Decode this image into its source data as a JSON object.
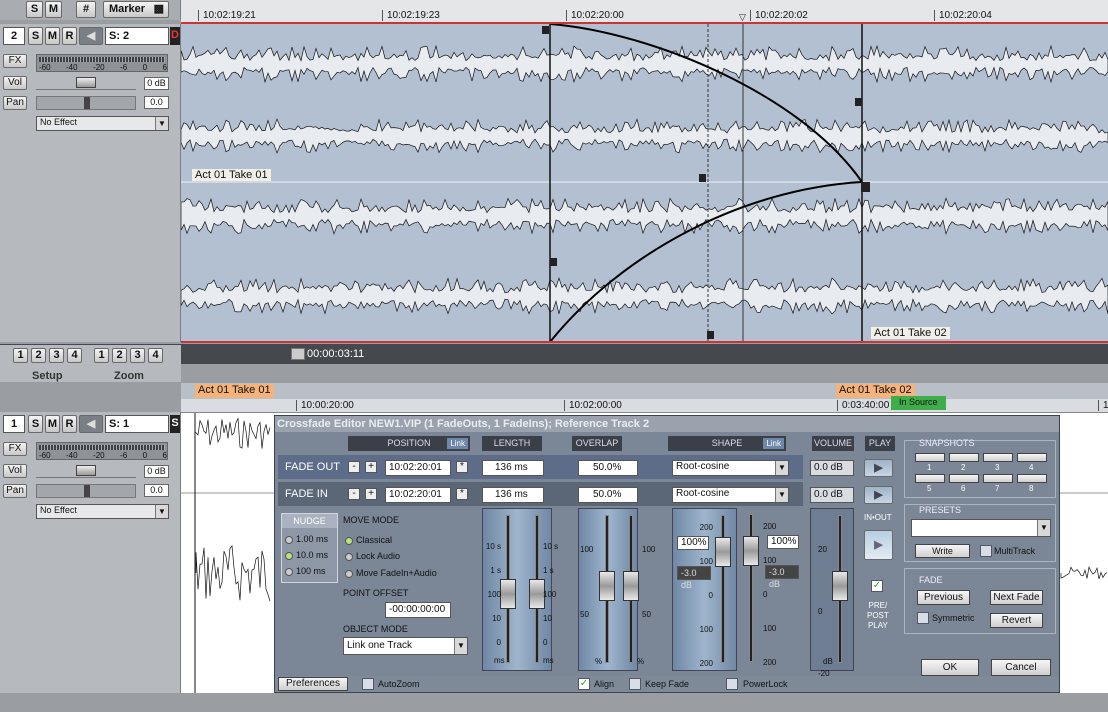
{
  "top_toolbar": {
    "s_label": "S",
    "m_label": "M",
    "grid_label": "#",
    "marker_label": "Marker"
  },
  "upper_ruler": {
    "times": [
      "10:02:19:21",
      "10:02:19:23",
      "10:02:20:00",
      "10:02:20:02",
      "10:02:20:04"
    ]
  },
  "track2": {
    "number": "2",
    "s": "S",
    "m": "M",
    "r": "R",
    "source": "S: 2",
    "d": "D",
    "fx": "FX",
    "vol": "Vol",
    "pan": "Pan",
    "vol_value": "0 dB",
    "pan_value": "0.0",
    "meter_scale": [
      "-60",
      "-40",
      "-20",
      "-6",
      "0",
      "6"
    ],
    "effect": "No Effect",
    "clip_a": "Act 01 Take 01",
    "clip_b": "Act 01 Take 02"
  },
  "transport": {
    "timecode": "00:00:03:11"
  },
  "setup": {
    "label": "Setup",
    "buttons": [
      "1",
      "2",
      "3",
      "4"
    ]
  },
  "zoom": {
    "label": "Zoom",
    "buttons": [
      "1",
      "2",
      "3",
      "4"
    ]
  },
  "lower_ruler": {
    "clip_a": "Act 01 Take 01",
    "clip_b": "Act 01 Take 02",
    "times": [
      "10:00:20:00",
      "10:02:00:00",
      "0:03:40:00",
      "1"
    ],
    "in_source": "In Source"
  },
  "track1": {
    "number": "1",
    "s": "S",
    "m": "M",
    "r": "R",
    "source": "S: 1",
    "side": "S",
    "fx": "FX",
    "vol": "Vol",
    "pan": "Pan",
    "vol_value": "0 dB",
    "pan_value": "0.0",
    "meter_scale": [
      "-60",
      "-40",
      "-20",
      "-6",
      "0",
      "6"
    ],
    "effect": "No Effect"
  },
  "dialog": {
    "title": "Crossfade Editor NEW1.VIP (1 FadeOuts, 1 FadeIns); Reference Track 2",
    "headers": {
      "position": "POSITION",
      "link": "Link",
      "length": "LENGTH",
      "overlap": "OVERLAP",
      "shape": "SHAPE",
      "shape_link": "Link",
      "volume": "VOLUME",
      "play": "PLAY"
    },
    "fade_out": {
      "label": "FADE OUT",
      "position": "10:02:20:01",
      "length": "136 ms",
      "overlap": "50.0%",
      "shape": "Root-cosine",
      "volume": "0.0 dB"
    },
    "fade_in": {
      "label": "FADE IN",
      "position": "10:02:20:01",
      "length": "136 ms",
      "overlap": "50.0%",
      "shape": "Root-cosine",
      "volume": "0.0 dB"
    },
    "minus": "-",
    "plus": "+",
    "star": "*",
    "nudge": {
      "title": "NUDGE",
      "options": [
        "1.00 ms",
        "10.0 ms",
        "100 ms"
      ],
      "selected": 1
    },
    "move_mode": {
      "title": "MOVE MODE",
      "options": [
        "Classical",
        "Lock Audio",
        "Move FadeIn+Audio"
      ],
      "selected": 0
    },
    "point_offset": {
      "title": "POINT OFFSET",
      "value": "-00:00:00:00"
    },
    "object_mode": {
      "title": "OBJECT MODE",
      "value": "Link one Track"
    },
    "length_scale_left": [
      "10 s",
      "1 s",
      "100",
      "10",
      "0"
    ],
    "length_scale_right": [
      "10 s",
      "1 s",
      "100",
      "10",
      "0"
    ],
    "length_unit": "ms",
    "overlap_scale_left": [
      "100",
      "50",
      "0"
    ],
    "overlap_scale_right": [
      "100",
      "50",
      "0"
    ],
    "overlap_unit": "%",
    "shape_scale_left": [
      "200",
      "100",
      "0",
      "100",
      "200"
    ],
    "shape_scale_right": [
      "200",
      "100",
      "0",
      "100",
      "200"
    ],
    "shape_pct_out": "100%",
    "shape_pct_in": "100%",
    "shape_db_out": "-3.0 dB",
    "shape_db_in": "-3.0 dB",
    "volume_scale": [
      "20",
      "0",
      "-20"
    ],
    "volume_unit": "dB",
    "in_out": "IN•OUT",
    "pre_post_play": [
      "PRE/",
      "POST",
      "PLAY"
    ],
    "snapshots": {
      "title": "SNAPSHOTS",
      "slots": [
        "1",
        "2",
        "3",
        "4",
        "5",
        "6",
        "7",
        "8"
      ]
    },
    "presets": {
      "title": "PRESETS",
      "write": "Write",
      "multitrack": "MultiTrack"
    },
    "fade": {
      "title": "FADE",
      "previous": "Previous",
      "next": "Next Fade",
      "symmetric": "Symmetric",
      "revert": "Revert"
    },
    "ok": "OK",
    "cancel": "Cancel",
    "preferences": "Preferences",
    "autozoom": "AutoZoom",
    "align": "Align",
    "keep_fade": "Keep Fade",
    "powerlock": "PowerLock"
  }
}
